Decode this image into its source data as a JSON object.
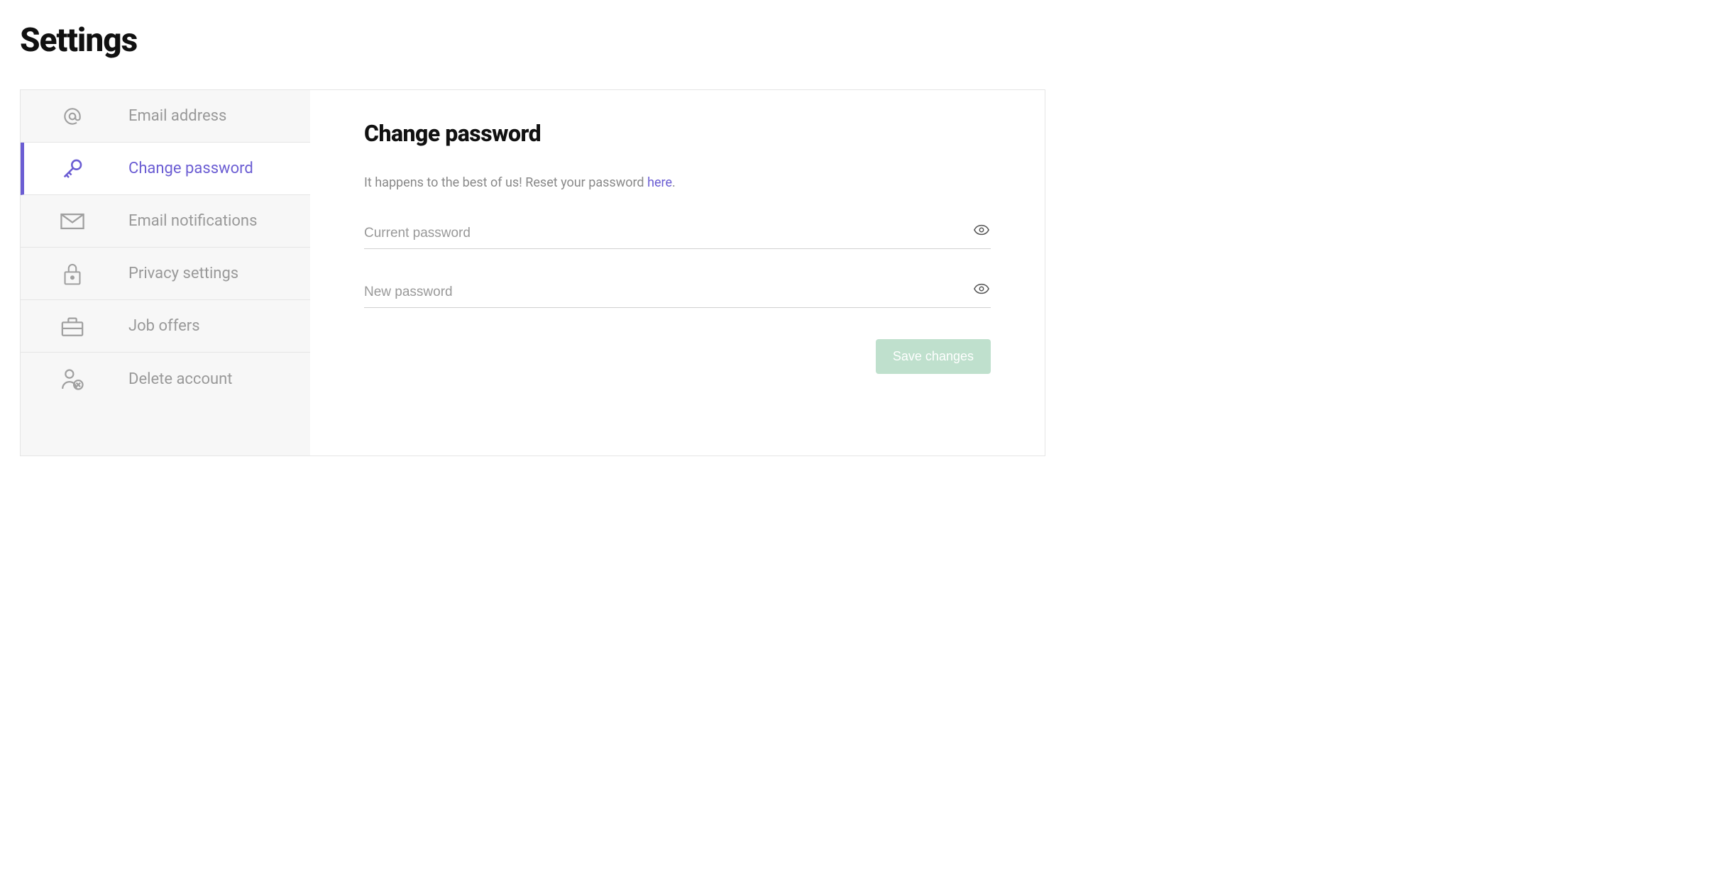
{
  "page": {
    "title": "Settings"
  },
  "sidebar": {
    "items": [
      {
        "icon": "at-icon",
        "label": "Email address",
        "active": false
      },
      {
        "icon": "key-icon",
        "label": "Change password",
        "active": true
      },
      {
        "icon": "envelope-icon",
        "label": "Email notifications",
        "active": false
      },
      {
        "icon": "lock-icon",
        "label": "Privacy settings",
        "active": false
      },
      {
        "icon": "briefcase-icon",
        "label": "Job offers",
        "active": false
      },
      {
        "icon": "user-delete-icon",
        "label": "Delete account",
        "active": false
      }
    ]
  },
  "main": {
    "title": "Change password",
    "helper_prefix": "It happens to the best of us! Reset your password ",
    "helper_link": "here",
    "helper_suffix": ".",
    "current_password_placeholder": "Current password",
    "new_password_placeholder": "New password",
    "save_label": "Save changes"
  }
}
